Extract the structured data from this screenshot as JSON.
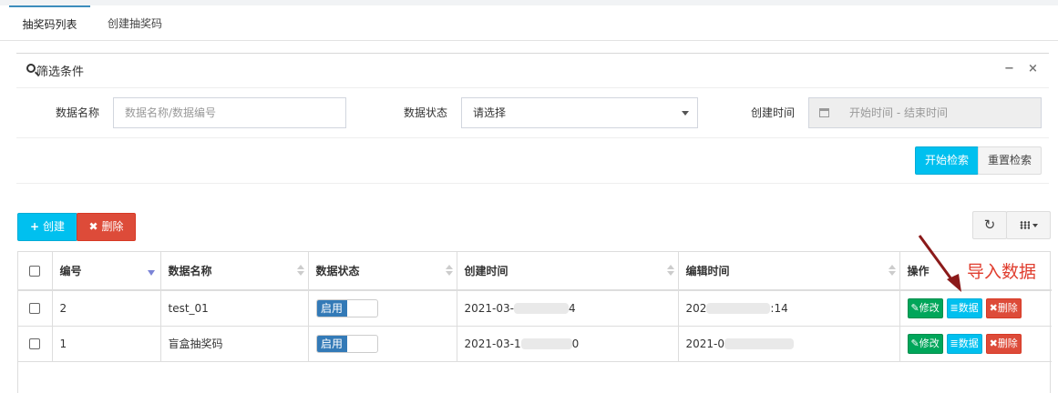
{
  "tabs": [
    {
      "label": "抽奖码列表",
      "active": true
    },
    {
      "label": "创建抽奖码",
      "active": false
    }
  ],
  "filter": {
    "title": "筛选条件",
    "minimize": "−",
    "close": "×",
    "name_label": "数据名称",
    "name_placeholder": "数据名称/数据编号",
    "status_label": "数据状态",
    "status_value": "请选择",
    "time_label": "创建时间",
    "time_placeholder": "开始时间 - 结束时间",
    "search_button": "开始检索",
    "reset_button": "重置检索"
  },
  "toolbar": {
    "create_label": "创建",
    "delete_label": "删除"
  },
  "table": {
    "headers": [
      "编号",
      "数据名称",
      "数据状态",
      "创建时间",
      "编辑时间",
      "操作"
    ],
    "rows": [
      {
        "id": "2",
        "name": "test_01",
        "status": "启用",
        "created_a": "2021-03-",
        "created_b": "4",
        "edited_a": "202",
        "edited_b": ":14"
      },
      {
        "id": "1",
        "name": "盲盒抽奖码",
        "status": "启用",
        "created_a": "2021-03-1",
        "created_b": "0",
        "edited_a": "2021-0",
        "edited_b": ""
      }
    ],
    "actions": {
      "edit": "修改",
      "data": "数据",
      "delete": "删除"
    }
  },
  "annotation": "导入数据",
  "colors": {
    "accent": "#00c0ef",
    "success": "#00a65a",
    "danger": "#dd4b39",
    "annotation": "#e03d2e"
  },
  "icons": [
    "search-icon",
    "calendar-icon",
    "plus-icon",
    "times-icon",
    "refresh-icon",
    "columns-icon",
    "edit-icon",
    "database-icon"
  ]
}
